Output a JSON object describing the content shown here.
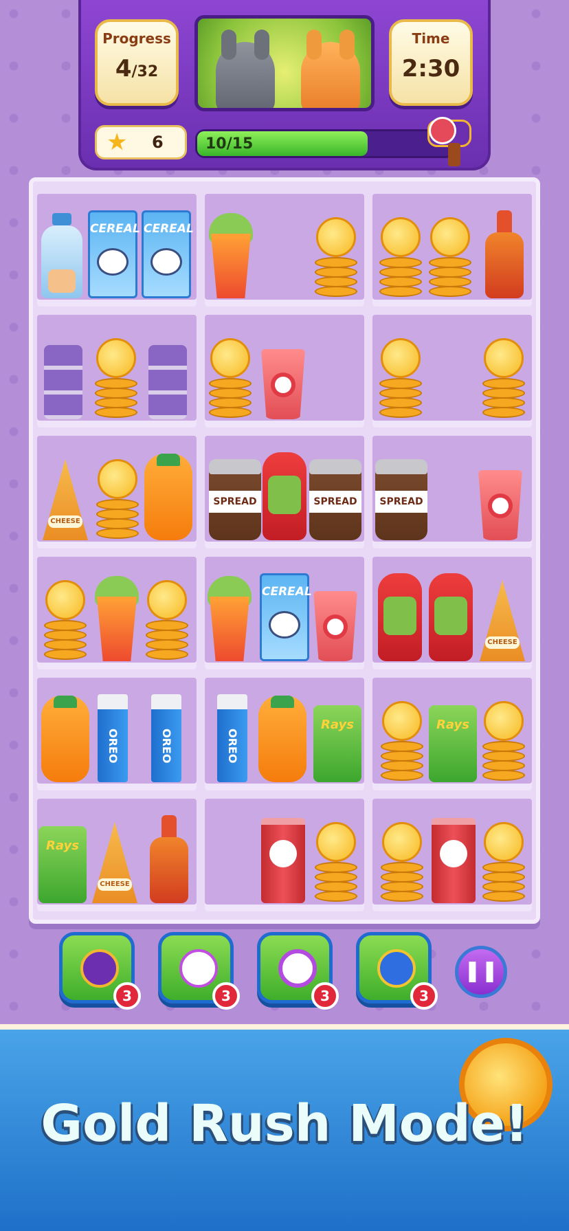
{
  "hud": {
    "progress_label": "Progress",
    "progress_current": "4",
    "progress_total": "/32",
    "time_label": "Time",
    "time_value": "2:30",
    "stars": "6",
    "bar_text": "10/15",
    "bar_fraction": 0.6667
  },
  "shelf": {
    "cereal": "CEREAL",
    "spread": "SPREAD",
    "cheese": "CHEESE",
    "oreo": "OREO",
    "rays": "Rays"
  },
  "tools": [
    {
      "name": "hammer",
      "count": "3"
    },
    {
      "name": "magic-wand",
      "count": "3"
    },
    {
      "name": "clock",
      "count": "3"
    },
    {
      "name": "shuffle",
      "count": "3"
    }
  ],
  "banner": {
    "title": "Gold Rush Mode!"
  },
  "colors": {
    "background": "#b58ed8",
    "hud": "#7a38c0",
    "progress_green": "#5fd53c",
    "tool_green": "#5cc23a",
    "badge_red": "#e0283a",
    "banner_blue": "#2f86d8"
  }
}
